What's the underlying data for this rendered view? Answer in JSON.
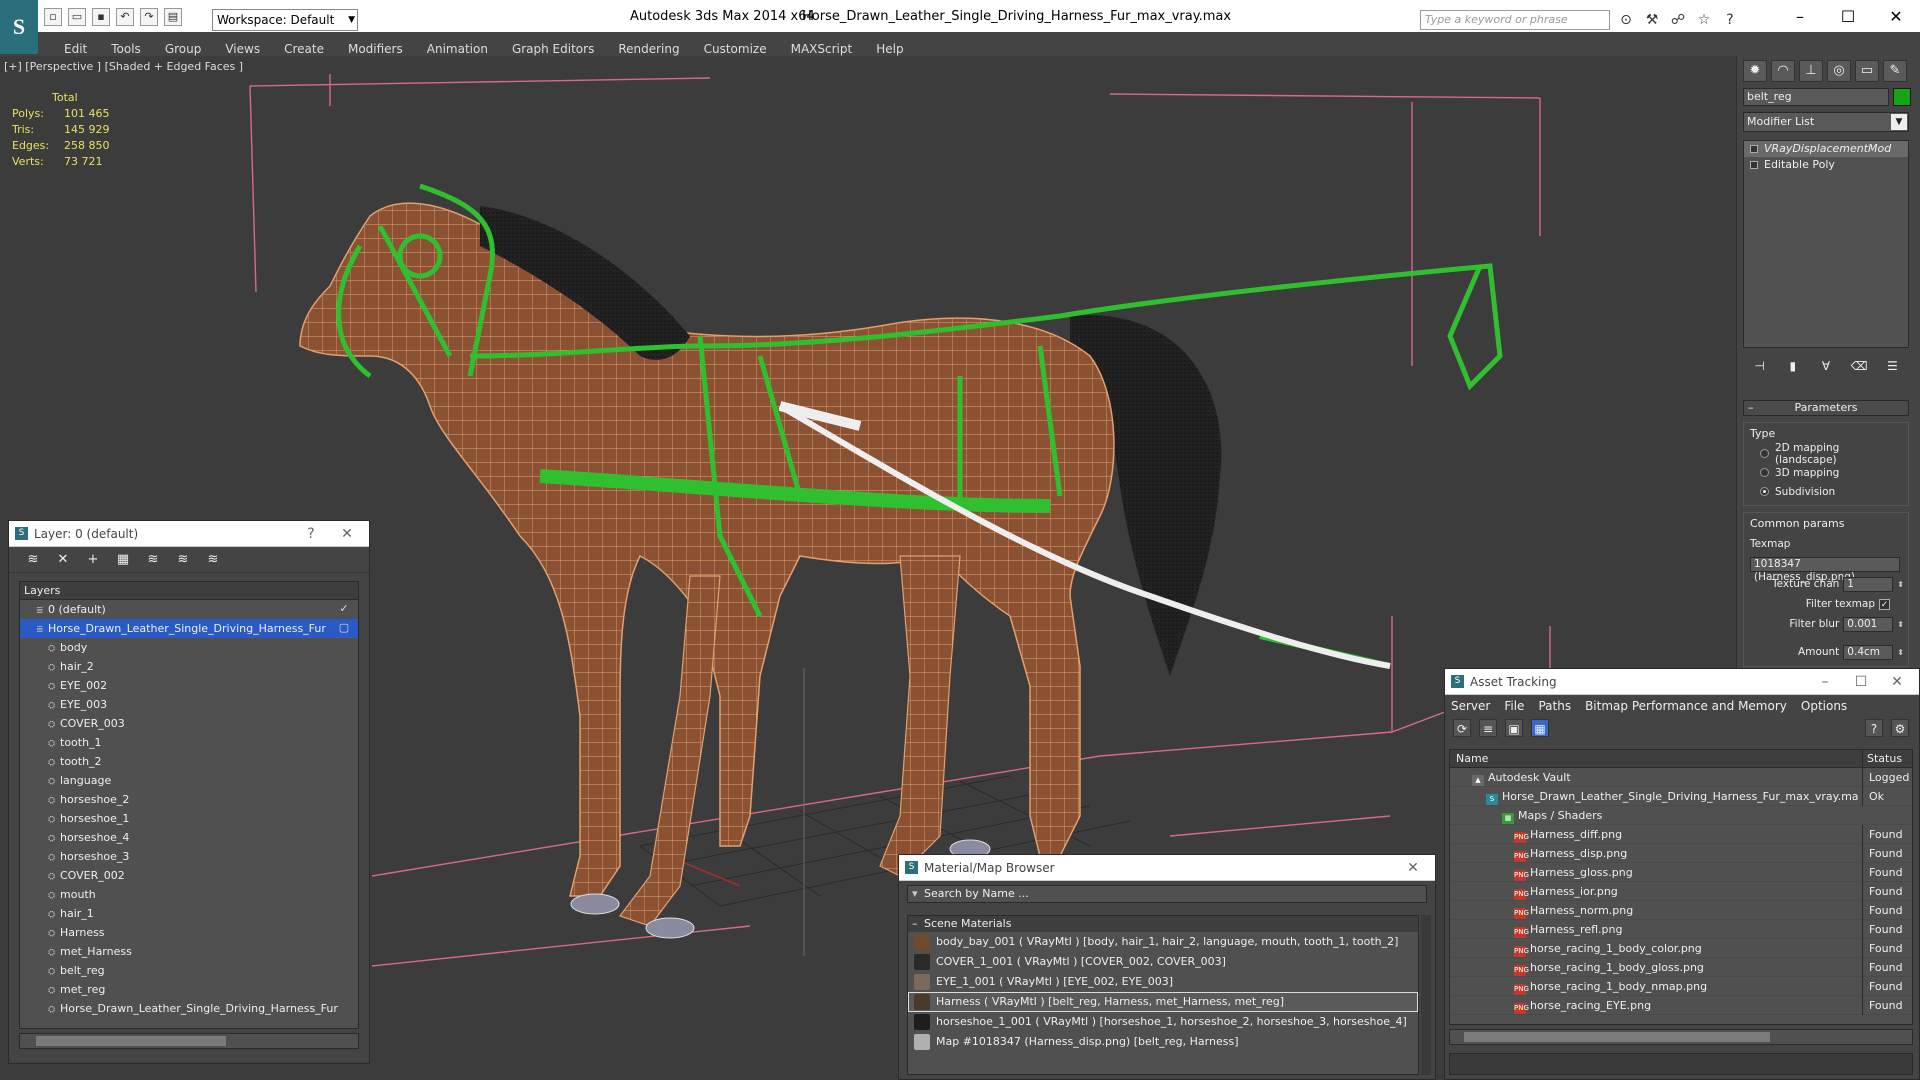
{
  "titlebar": {
    "workspace": "Workspace: Default",
    "app_title": "Autodesk 3ds Max  2014 x64",
    "file_title": "Horse_Drawn_Leather_Single_Driving_Harness_Fur_max_vray.max",
    "search_placeholder": "Type a keyword or phrase"
  },
  "menus": [
    "Edit",
    "Tools",
    "Group",
    "Views",
    "Create",
    "Modifiers",
    "Animation",
    "Graph Editors",
    "Rendering",
    "Customize",
    "MAXScript",
    "Help"
  ],
  "viewport": {
    "label": "[+] [Perspective ] [Shaded + Edged Faces ]",
    "stats_header": "Total",
    "stats": [
      {
        "k": "Polys:",
        "v": "101 465"
      },
      {
        "k": "Tris:",
        "v": "145 929"
      },
      {
        "k": "Edges:",
        "v": "258 850"
      },
      {
        "k": "Verts:",
        "v": "73 721"
      }
    ]
  },
  "command_panel": {
    "object_name": "belt_reg",
    "object_color": "#16a516",
    "modifier_list": "Modifier List",
    "stack": [
      "VRayDisplacementMod",
      "Editable Poly"
    ],
    "parameters_title": "Parameters",
    "type_label": "Type",
    "type_options": [
      "2D mapping (landscape)",
      "3D mapping",
      "Subdivision"
    ],
    "type_selected": "Subdivision",
    "common_label": "Common params",
    "texmap_label": "Texmap",
    "texmap_value": "1018347 (Harness_disp.png)",
    "texture_chan_label": "Texture chan",
    "texture_chan_value": "1",
    "filter_texmap_label": "Filter texmap",
    "filter_blur_label": "Filter blur",
    "filter_blur_value": "0.001",
    "amount_label": "Amount",
    "amount_value": "0.4cm"
  },
  "layers_window": {
    "title": "Layer: 0 (default)",
    "help": "?",
    "column": "Layers",
    "rows": [
      {
        "name": "0 (default)",
        "level": 1
      },
      {
        "name": "Horse_Drawn_Leather_Single_Driving_Harness_Fur",
        "level": 1,
        "selected": true
      },
      {
        "name": "body",
        "level": 2
      },
      {
        "name": "hair_2",
        "level": 2
      },
      {
        "name": "EYE_002",
        "level": 2
      },
      {
        "name": "EYE_003",
        "level": 2
      },
      {
        "name": "COVER_003",
        "level": 2
      },
      {
        "name": "tooth_1",
        "level": 2
      },
      {
        "name": "tooth_2",
        "level": 2
      },
      {
        "name": "language",
        "level": 2
      },
      {
        "name": "horseshoe_2",
        "level": 2
      },
      {
        "name": "horseshoe_1",
        "level": 2
      },
      {
        "name": "horseshoe_4",
        "level": 2
      },
      {
        "name": "horseshoe_3",
        "level": 2
      },
      {
        "name": "COVER_002",
        "level": 2
      },
      {
        "name": "mouth",
        "level": 2
      },
      {
        "name": "hair_1",
        "level": 2
      },
      {
        "name": "Harness",
        "level": 2
      },
      {
        "name": "met_Harness",
        "level": 2
      },
      {
        "name": "belt_reg",
        "level": 2
      },
      {
        "name": "met_reg",
        "level": 2
      },
      {
        "name": "Horse_Drawn_Leather_Single_Driving_Harness_Fur",
        "level": 2
      }
    ]
  },
  "material_browser": {
    "title": "Material/Map Browser",
    "search_placeholder": "Search by Name ...",
    "section": "Scene Materials",
    "rows": [
      {
        "text": "body_bay_001  ( VRayMtl )  [body, hair_1, hair_2, language, mouth, tooth_1, tooth_2]",
        "swatch": "#6e4a2e"
      },
      {
        "text": "COVER_1_001  ( VRayMtl )  [COVER_002, COVER_003]",
        "swatch": "#2a2a2a"
      },
      {
        "text": "EYE_1_001  ( VRayMtl )  [EYE_002, EYE_003]",
        "swatch": "#7a6a5a"
      },
      {
        "text": "Harness  ( VRayMtl )  [belt_reg, Harness, met_Harness, met_reg]",
        "swatch": "#4a3a2a",
        "selected": true
      },
      {
        "text": "horseshoe_1_001  ( VRayMtl )  [horseshoe_1, horseshoe_2, horseshoe_3, horseshoe_4]",
        "swatch": "#1e1e1e"
      },
      {
        "text": "Map #1018347 (Harness_disp.png)  [belt_reg, Harness]",
        "swatch": "#b0b0b0"
      }
    ]
  },
  "asset_tracking": {
    "title": "Asset Tracking",
    "menus": [
      "Server",
      "File",
      "Paths",
      "Bitmap Performance and Memory",
      "Options"
    ],
    "col_name": "Name",
    "col_status": "Status",
    "rows": [
      {
        "name": "Autodesk Vault",
        "status": "Logged",
        "level": 1,
        "icon": "vault-icon"
      },
      {
        "name": "Horse_Drawn_Leather_Single_Driving_Harness_Fur_max_vray.max",
        "status": "Ok",
        "level": 2,
        "icon": "max-file-icon"
      },
      {
        "name": "Maps / Shaders",
        "status": "",
        "level": 3,
        "icon": "maps-icon"
      },
      {
        "name": "Harness_diff.png",
        "status": "Found",
        "level": 4,
        "icon": "png-icon"
      },
      {
        "name": "Harness_disp.png",
        "status": "Found",
        "level": 4,
        "icon": "png-icon"
      },
      {
        "name": "Harness_gloss.png",
        "status": "Found",
        "level": 4,
        "icon": "png-icon"
      },
      {
        "name": "Harness_ior.png",
        "status": "Found",
        "level": 4,
        "icon": "png-icon"
      },
      {
        "name": "Harness_norm.png",
        "status": "Found",
        "level": 4,
        "icon": "png-icon"
      },
      {
        "name": "Harness_refl.png",
        "status": "Found",
        "level": 4,
        "icon": "png-icon"
      },
      {
        "name": "horse_racing_1_body_color.png",
        "status": "Found",
        "level": 4,
        "icon": "png-icon"
      },
      {
        "name": "horse_racing_1_body_gloss.png",
        "status": "Found",
        "level": 4,
        "icon": "png-icon"
      },
      {
        "name": "horse_racing_1_body_nmap.png",
        "status": "Found",
        "level": 4,
        "icon": "png-icon"
      },
      {
        "name": "horse_racing_EYE.png",
        "status": "Found",
        "level": 4,
        "icon": "png-icon"
      }
    ]
  }
}
